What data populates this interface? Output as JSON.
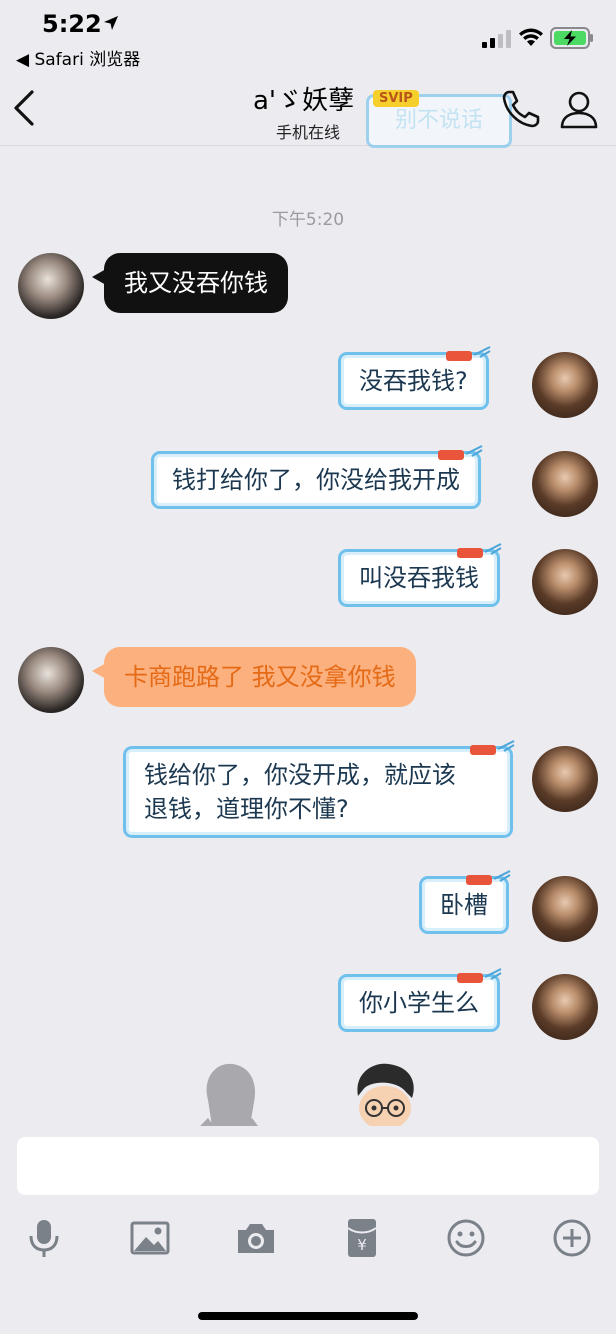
{
  "status_bar": {
    "time": "5:22",
    "back_app": "◀ Safari 浏览器"
  },
  "nav": {
    "contact_name": "a'ゞ妖孽",
    "badge": "SVIP",
    "online_status": "手机在线",
    "watermark": "别不说话"
  },
  "chat": {
    "timestamp": "下午5:20",
    "messages": [
      {
        "side": "left",
        "text": "我又没吞你钱"
      },
      {
        "side": "right",
        "text": "没吞我钱?"
      },
      {
        "side": "right",
        "text": "钱打给你了，你没给我开成"
      },
      {
        "side": "right",
        "text": "叫没吞我钱"
      },
      {
        "side": "left",
        "text": "卡商跑路了 我又没拿你钱"
      },
      {
        "side": "right",
        "line1": "钱给你了，你没开成，就应该",
        "line2": "退钱，道理你不懂?"
      },
      {
        "side": "right",
        "text": "卧槽"
      },
      {
        "side": "right",
        "text": "你小学生么"
      }
    ]
  },
  "input": {
    "value": ""
  },
  "toolbar": {
    "icons": [
      "microphone-icon",
      "image-icon",
      "camera-icon",
      "red-packet-icon",
      "emoji-icon",
      "plus-icon"
    ]
  },
  "colors": {
    "background": "#ebebf0",
    "outgoing_border": "#6fc1ec",
    "outgoing_text": "#1c3850",
    "incoming_orange_bg": "#fbb07d",
    "incoming_orange_text": "#e56a16",
    "svip_gold": "#f6cf2c"
  }
}
